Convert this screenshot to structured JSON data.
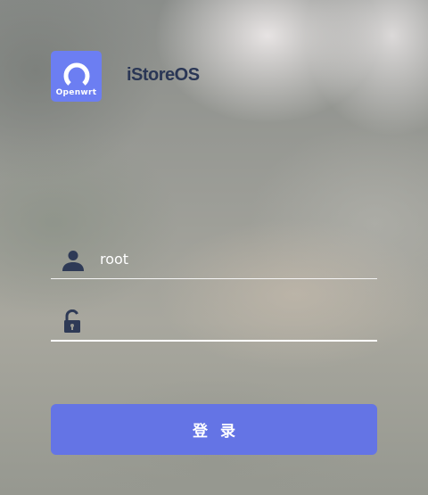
{
  "brand": {
    "logo_caption": "Openwrt",
    "name": "iStoreOS",
    "accent_color": "#6c7ef2"
  },
  "form": {
    "username": {
      "icon": "user-icon",
      "value": "root",
      "placeholder": ""
    },
    "password": {
      "icon": "unlocked-padlock-icon",
      "value": "",
      "placeholder": ""
    },
    "submit_label": "登录",
    "submit_color": "#6474e5"
  }
}
